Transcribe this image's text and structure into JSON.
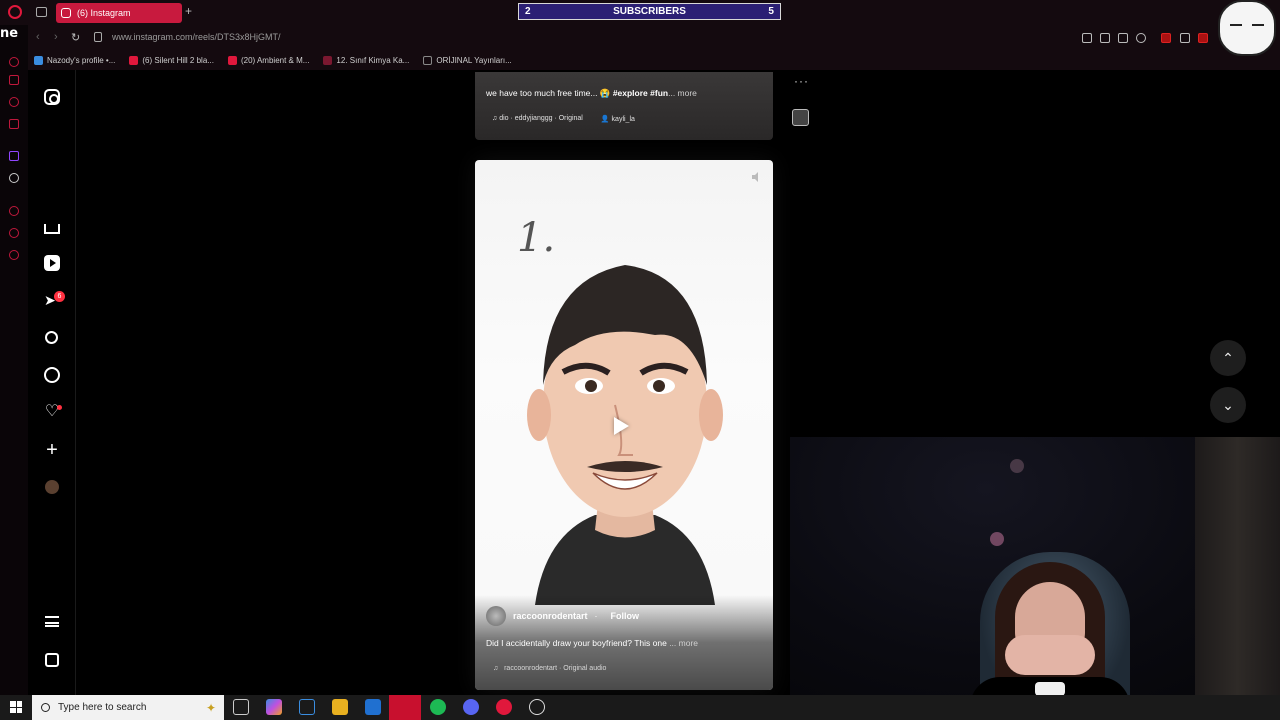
{
  "browser": {
    "tab_title": "(6) Instagram",
    "url": "www.instagram.com/reels/DTS3x8HjGMT/",
    "bookmarks": [
      {
        "label": "Nazody's profile •...",
        "color": "#3a8de0"
      },
      {
        "label": "(6) Silent Hill 2 bla...",
        "color": "#e0183c"
      },
      {
        "label": "(20) Ambient & M...",
        "color": "#e0183c"
      },
      {
        "label": "12. Sınıf Kimya Ka...",
        "color": "#7a1830"
      },
      {
        "label": "ORİJINAL Yayınları...",
        "color": "#888888"
      }
    ]
  },
  "overlay": {
    "subs_left": "2",
    "subs_label": "SUBSCRIBERS",
    "subs_right": "5"
  },
  "instagram": {
    "notifications_badge": "6",
    "previous_reel": {
      "caption_text": "we have too much free time... 😭 ",
      "caption_tags": "#explore #fun",
      "caption_more": "... more",
      "audio": "dio · eddyjianggg · Original",
      "tagged": "kayli_la"
    },
    "current_reel": {
      "handwritten": "1.",
      "author": "raccoonrodentart",
      "follow_label": "Follow",
      "caption": "Did I accidentally draw your boyfriend? This one",
      "caption_more": "... more",
      "audio": "raccoonrodentart · Original audio"
    }
  },
  "taskbar": {
    "search_placeholder": "Type here to search"
  }
}
